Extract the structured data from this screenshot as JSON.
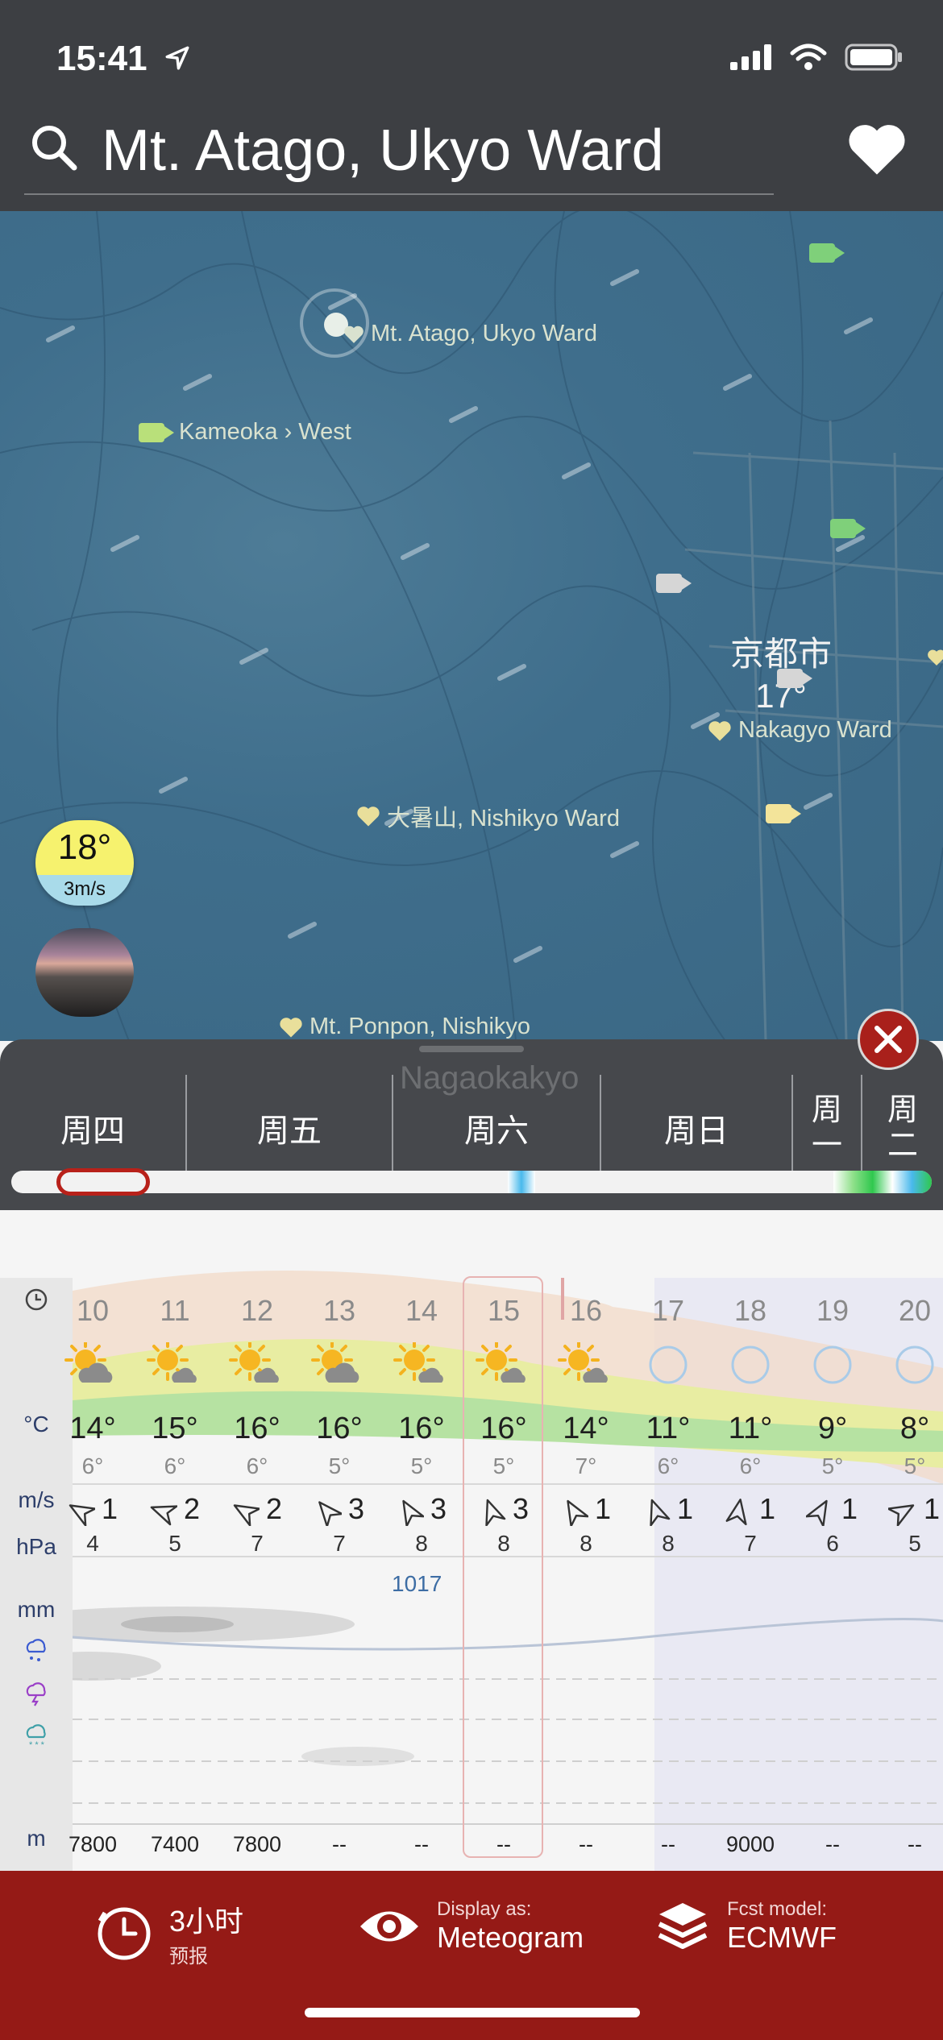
{
  "status_bar": {
    "time": "15:41"
  },
  "search": {
    "title": "Mt. Atago, Ukyo Ward"
  },
  "map": {
    "labels": {
      "kameoka": "Kameoka › West",
      "atago": "Mt. Atago, Ukyo Ward",
      "kyoto_city": "京都市",
      "kyoto_temp": "17°",
      "nakagyo": "Nakagyo Ward",
      "ooshoyama": "大暑山, Nishikyo Ward",
      "ponpon": "Mt. Ponpon, Nishikyo",
      "nagaokakyo": "Nagaokakyo"
    },
    "current_temp": "18°",
    "current_wind": "3m/s"
  },
  "days": [
    "周四",
    "周五",
    "周六",
    "周日",
    "周一",
    "周二"
  ],
  "days_narrow": [
    [
      "周",
      "一"
    ],
    [
      "周",
      "二"
    ]
  ],
  "meteogram": {
    "axis": {
      "temp": "°C",
      "wind": "m/s",
      "pressure": "hPa",
      "precip": "mm",
      "alt": "m"
    },
    "hours": [
      "10",
      "11",
      "12",
      "13",
      "14",
      "15",
      "16",
      "17",
      "18",
      "19",
      "20"
    ],
    "tmax": [
      "14°",
      "15°",
      "16°",
      "16°",
      "16°",
      "16°",
      "14°",
      "11°",
      "11°",
      "9°",
      "8°"
    ],
    "tmin": [
      "6°",
      "6°",
      "6°",
      "5°",
      "5°",
      "5°",
      "7°",
      "6°",
      "6°",
      "5°",
      "5°"
    ],
    "wind": [
      "1",
      "2",
      "2",
      "3",
      "3",
      "3",
      "1",
      "1",
      "1",
      "1",
      "1"
    ],
    "gust": [
      "4",
      "5",
      "7",
      "7",
      "8",
      "8",
      "8",
      "8",
      "7",
      "6",
      "5"
    ],
    "pressure": "1017",
    "altitude": [
      "7800",
      "7400",
      "7800",
      "--",
      "--",
      "--",
      "--",
      "--",
      "9000",
      "--",
      "--"
    ]
  },
  "footer": {
    "interval_big": "3小时",
    "interval_small": "预报",
    "display_small": "Display as:",
    "display_big": "Meteogram",
    "model_small": "Fcst model:",
    "model_big": "ECMWF"
  }
}
